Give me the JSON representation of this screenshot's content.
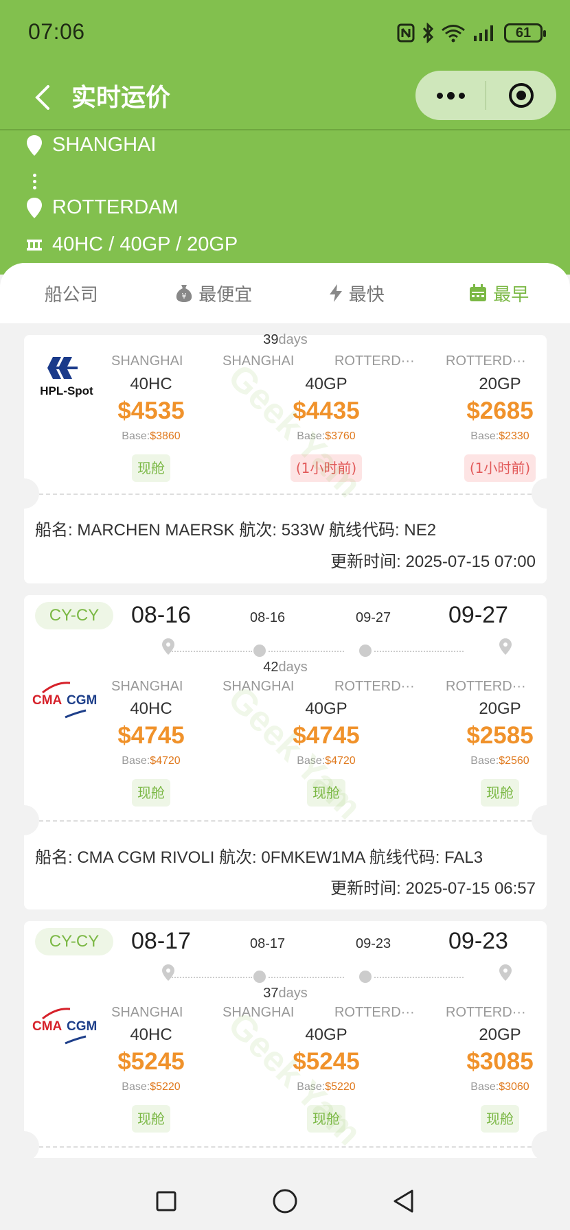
{
  "status": {
    "time": "07:06",
    "battery": "61"
  },
  "nav": {
    "title": "实时运价"
  },
  "route": {
    "origin": "SHANGHAI",
    "destination": "ROTTERDAM",
    "containers": "40HC / 40GP / 20GP"
  },
  "tabs": [
    {
      "label": "船公司",
      "icon": ""
    },
    {
      "label": "最便宜",
      "icon": "money-bag-icon"
    },
    {
      "label": "最快",
      "icon": "lightning-icon"
    },
    {
      "label": "最早",
      "icon": "calendar-icon"
    }
  ],
  "active_tab": "最早",
  "cards": [
    {
      "carrier": "HPL-Spot",
      "days_num": "39",
      "days_unit": "days",
      "ports": [
        "SHANGHAI",
        "SHANGHAI",
        "ROTTERD···",
        "ROTTERD···"
      ],
      "prices": [
        {
          "type": "40HC",
          "price": "$4535",
          "base_label": "Base:",
          "base": "$3860",
          "tag": "现舱",
          "tag_color": "green"
        },
        {
          "type": "40GP",
          "price": "$4435",
          "base_label": "Base:",
          "base": "$3760",
          "tag": "(1小时前)",
          "tag_color": "red"
        },
        {
          "type": "20GP",
          "price": "$2685",
          "base_label": "Base:",
          "base": "$2330",
          "tag": "(1小时前)",
          "tag_color": "red"
        }
      ],
      "ship_info": "船名: MARCHEN MAERSK 航次: 533W 航线代码: NE2",
      "updated": "更新时间: 2025-07-15 07:00"
    },
    {
      "mode": "CY-CY",
      "carrier": "CMA CGM",
      "etd": "08-16",
      "dep": "08-16",
      "arr": "09-27",
      "eta": "09-27",
      "days_num": "42",
      "days_unit": "days",
      "ports": [
        "SHANGHAI",
        "SHANGHAI",
        "ROTTERD···",
        "ROTTERD···"
      ],
      "prices": [
        {
          "type": "40HC",
          "price": "$4745",
          "base_label": "Base:",
          "base": "$4720",
          "tag": "现舱",
          "tag_color": "green"
        },
        {
          "type": "40GP",
          "price": "$4745",
          "base_label": "Base:",
          "base": "$4720",
          "tag": "现舱",
          "tag_color": "green"
        },
        {
          "type": "20GP",
          "price": "$2585",
          "base_label": "Base:",
          "base": "$2560",
          "tag": "现舱",
          "tag_color": "green"
        }
      ],
      "ship_info": "船名: CMA CGM RIVOLI 航次: 0FMKEW1MA 航线代码: FAL3",
      "updated": "更新时间: 2025-07-15 06:57"
    },
    {
      "mode": "CY-CY",
      "carrier": "CMA CGM",
      "etd": "08-17",
      "dep": "08-17",
      "arr": "09-23",
      "eta": "09-23",
      "days_num": "37",
      "days_unit": "days",
      "ports": [
        "SHANGHAI",
        "SHANGHAI",
        "ROTTERD···",
        "ROTTERD···"
      ],
      "prices": [
        {
          "type": "40HC",
          "price": "$5245",
          "base_label": "Base:",
          "base": "$5220",
          "tag": "现舱",
          "tag_color": "green"
        },
        {
          "type": "40GP",
          "price": "$5245",
          "base_label": "Base:",
          "base": "$5220",
          "tag": "现舱",
          "tag_color": "green"
        },
        {
          "type": "20GP",
          "price": "$3085",
          "base_label": "Base:",
          "base": "$3060",
          "tag": "现舱",
          "tag_color": "green"
        }
      ]
    }
  ],
  "watermark": "Geek Yam",
  "colors": {
    "header": "#82c04e",
    "accent": "#7bb845",
    "price": "#f0922b",
    "red": "#e25a5a"
  }
}
